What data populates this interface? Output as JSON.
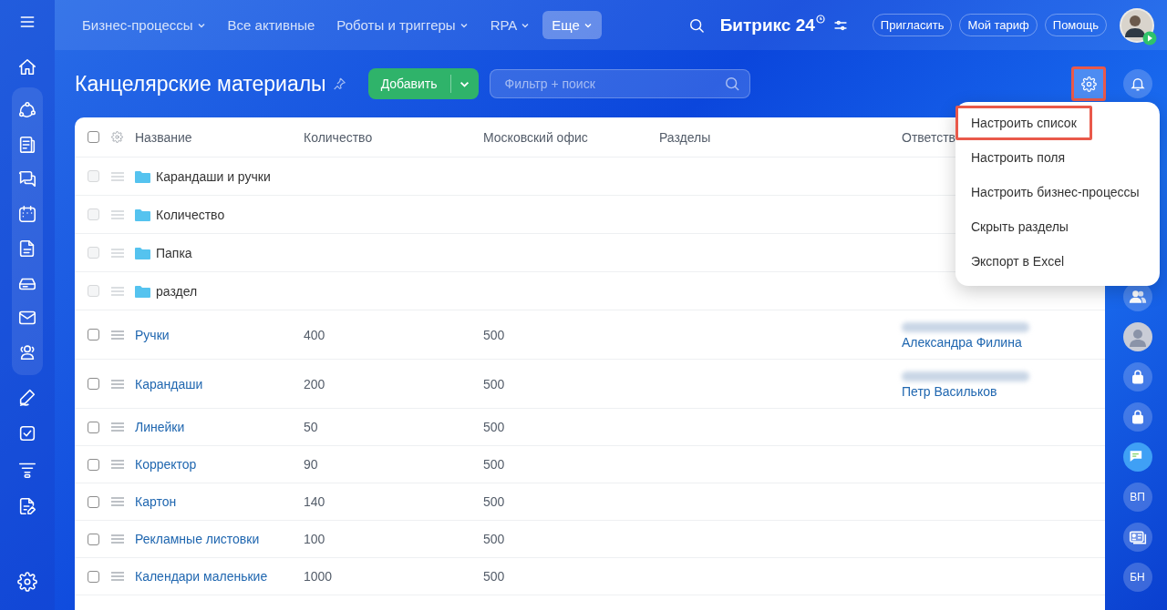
{
  "top_nav": {
    "items": [
      {
        "label": "Бизнес-процессы",
        "dropdown": true,
        "selected": false
      },
      {
        "label": "Все активные",
        "dropdown": false,
        "selected": false
      },
      {
        "label": "Роботы и триггеры",
        "dropdown": true,
        "selected": false
      },
      {
        "label": "RPA",
        "dropdown": true,
        "selected": false
      },
      {
        "label": "Еще",
        "dropdown": true,
        "selected": true
      }
    ],
    "logo": "Битрикс 24",
    "buttons": [
      "Пригласить",
      "Мой тариф",
      "Помощь"
    ]
  },
  "page": {
    "title": "Канцелярские материалы",
    "add_button": "Добавить",
    "search": {
      "placeholder": "Фильтр + поиск"
    },
    "settings_highlighted": true
  },
  "settings_menu": {
    "items": [
      {
        "label": "Настроить список",
        "highlighted": true
      },
      {
        "label": "Настроить поля",
        "highlighted": false
      },
      {
        "label": "Настроить бизнес-процессы",
        "highlighted": false
      },
      {
        "label": "Скрыть разделы",
        "highlighted": false
      },
      {
        "label": "Экспорт в Excel",
        "highlighted": false
      }
    ]
  },
  "table": {
    "select_all_checked": false,
    "columns": [
      "Название",
      "Количество",
      "Московский офис",
      "Разделы",
      "Ответств"
    ],
    "rows": [
      {
        "kind": "folder",
        "name": "Карандаши и ручки",
        "checked": false,
        "disabled": true
      },
      {
        "kind": "folder",
        "name": "Количество",
        "checked": false,
        "disabled": true
      },
      {
        "kind": "folder",
        "name": "Папка",
        "checked": false,
        "disabled": true
      },
      {
        "kind": "folder",
        "name": "раздел",
        "checked": false,
        "disabled": true
      },
      {
        "kind": "item",
        "name": "Ручки",
        "quantity": "400",
        "office": "500",
        "blurred_email": true,
        "responsible": "Александра Филина",
        "checked": false,
        "disabled": false
      },
      {
        "kind": "item",
        "name": "Карандаши",
        "quantity": "200",
        "office": "500",
        "blurred_email": true,
        "responsible": "Петр Васильков",
        "checked": false,
        "disabled": false
      },
      {
        "kind": "item",
        "name": "Линейки",
        "quantity": "50",
        "office": "500",
        "blurred_email": false,
        "checked": false,
        "disabled": false
      },
      {
        "kind": "item",
        "name": "Корректор",
        "quantity": "90",
        "office": "500",
        "blurred_email": false,
        "checked": false,
        "disabled": false
      },
      {
        "kind": "item",
        "name": "Картон",
        "quantity": "140",
        "office": "500",
        "blurred_email": false,
        "checked": false,
        "disabled": false
      },
      {
        "kind": "item",
        "name": "Рекламные листовки",
        "quantity": "100",
        "office": "500",
        "blurred_email": false,
        "checked": false,
        "disabled": false
      },
      {
        "kind": "item",
        "name": "Календари маленькие",
        "quantity": "1000",
        "office": "500",
        "blurred_email": false,
        "checked": false,
        "disabled": false
      }
    ]
  },
  "right_panel": {
    "items": [
      {
        "kind": "group"
      },
      {
        "kind": "avatar"
      },
      {
        "kind": "lock"
      },
      {
        "kind": "lock"
      },
      {
        "kind": "chat"
      },
      {
        "kind": "initials",
        "text": "ВП"
      },
      {
        "kind": "card"
      },
      {
        "kind": "initials",
        "text": "БН"
      }
    ]
  }
}
